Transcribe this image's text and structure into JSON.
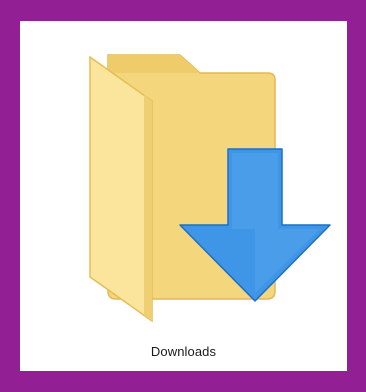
{
  "item": {
    "label": "Downloads",
    "icon": "downloads-folder-icon"
  },
  "colors": {
    "frame_border": "#931f95",
    "tile_background": "#ffffff",
    "folder_back": "#f5d67e",
    "folder_front": "#fbe59a",
    "folder_edge": "#e8bf56",
    "arrow_fill": "#3f95e6",
    "arrow_edge": "#1d6fc6"
  }
}
